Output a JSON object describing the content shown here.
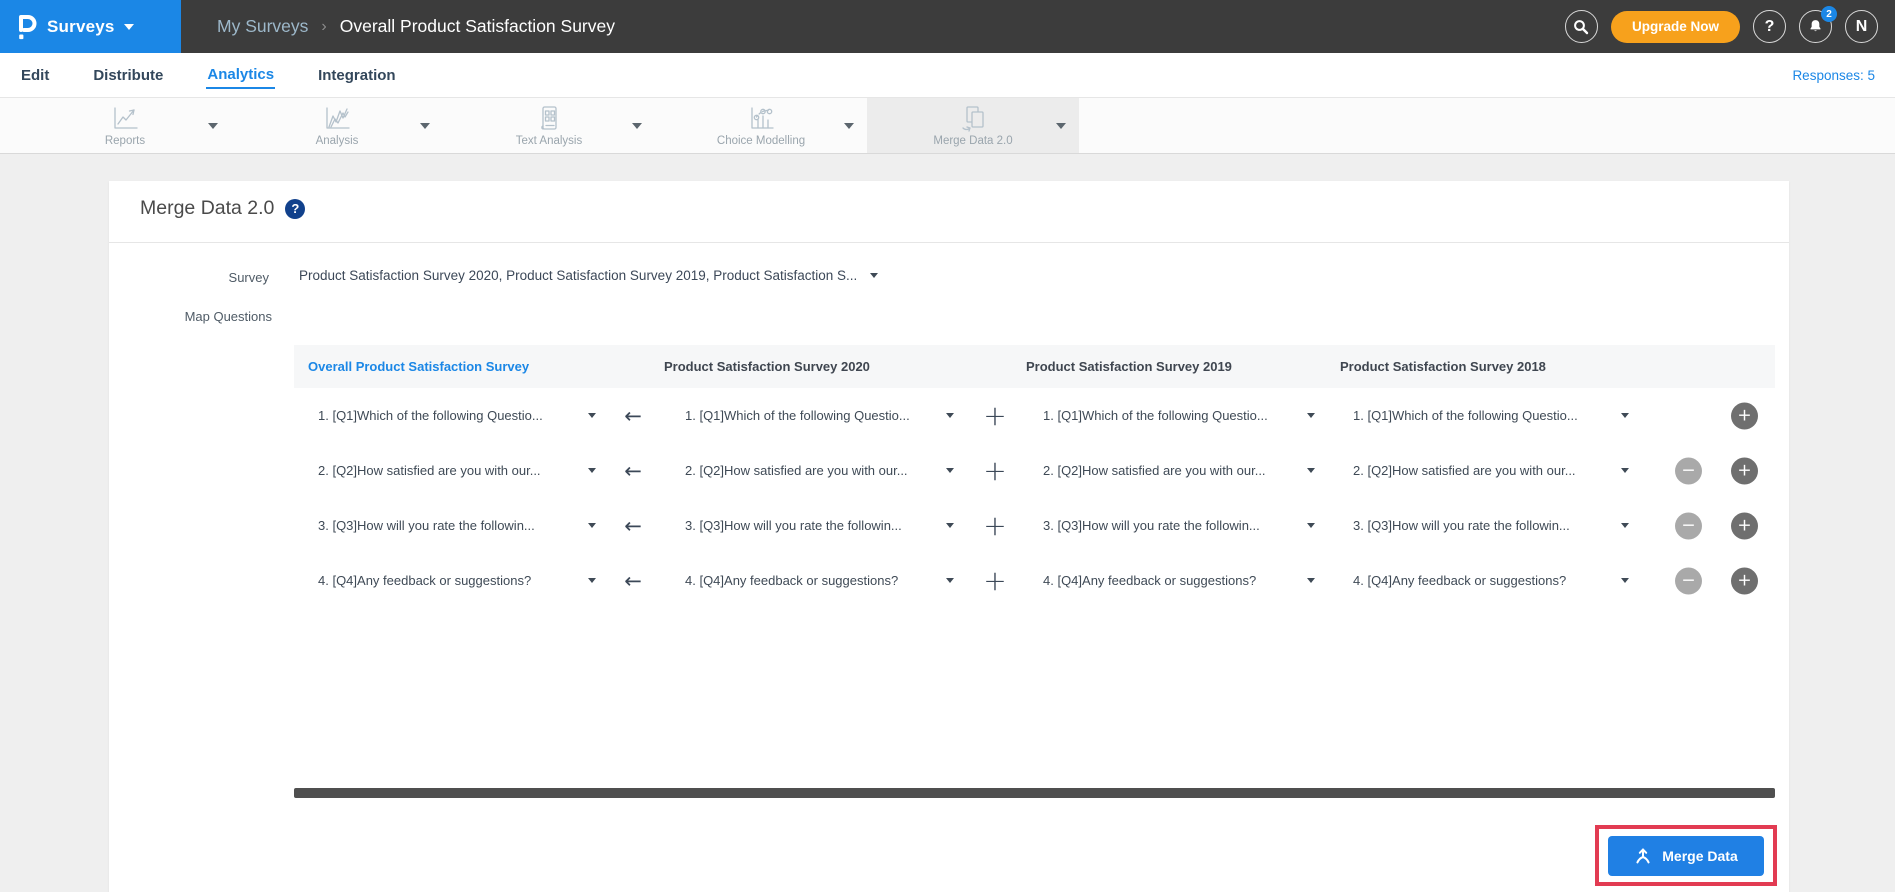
{
  "topbar": {
    "app_name": "Surveys",
    "breadcrumb_parent": "My Surveys",
    "breadcrumb_separator": "›",
    "breadcrumb_current": "Overall Product Satisfaction Survey",
    "upgrade_button": "Upgrade Now",
    "help_glyph": "?",
    "notification_badge": "2",
    "avatar_initial": "N"
  },
  "nav": {
    "tabs": [
      {
        "label": "Edit"
      },
      {
        "label": "Distribute"
      },
      {
        "label": "Analytics"
      },
      {
        "label": "Integration"
      }
    ],
    "responses": "Responses: 5"
  },
  "subnav": {
    "tabs": [
      {
        "label": "Reports"
      },
      {
        "label": "Analysis"
      },
      {
        "label": "Text Analysis"
      },
      {
        "label": "Choice Modelling"
      },
      {
        "label": "Merge Data 2.0"
      }
    ]
  },
  "panel": {
    "title": "Merge Data 2.0",
    "help_glyph": "?",
    "survey_label": "Survey",
    "survey_value": "Product Satisfaction Survey 2020, Product Satisfaction Survey 2019, Product Satisfaction S...",
    "map_questions_label": "Map Questions",
    "column_headers": [
      "Overall Product Satisfaction Survey",
      "Product Satisfaction Survey 2020",
      "Product Satisfaction Survey 2019",
      "Product Satisfaction Survey 2018"
    ],
    "rows": [
      {
        "question": "1. [Q1]Which of the following Questio..."
      },
      {
        "question": "2. [Q2]How satisfied are you with our..."
      },
      {
        "question": "3. [Q3]How will you rate the followin..."
      },
      {
        "question": "4. [Q4]Any feedback or suggestions?"
      }
    ],
    "glyphs": {
      "map_arrow": "←",
      "append_plus": "+",
      "minus": "−",
      "plus": "+"
    },
    "merge_button_label": "Merge Data"
  },
  "colors": {
    "brand_blue": "#1b87e6",
    "topbar_dark": "#3c3c3c",
    "upgrade_orange": "#f7a11c",
    "header_link_blue": "#1b87e6",
    "highlight_red": "#e23b52",
    "scrollbar_dark": "#4f4f4f",
    "merge_button_blue": "#2080e4"
  }
}
